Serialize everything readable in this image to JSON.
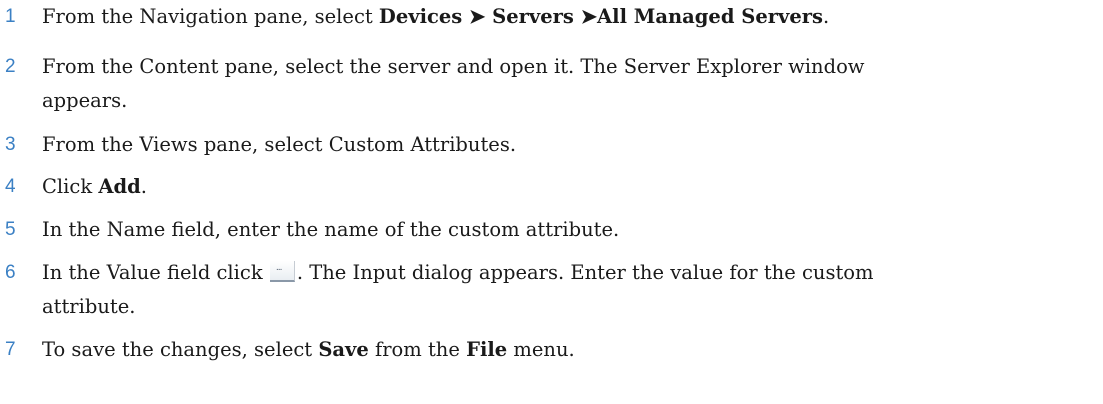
{
  "steps": [
    {
      "number": "1",
      "lines": [
        [
          {
            "text": "From the Navigation pane, select "
          },
          {
            "text": "Devices ➤ Servers ➤All Managed Servers",
            "bold": true
          },
          {
            "text": "."
          }
        ]
      ]
    },
    {
      "number": "2",
      "lines": [
        [
          {
            "text": "From the Content pane, select the server and open it. The Server Explorer window"
          }
        ],
        [
          {
            "text": "appears."
          }
        ]
      ]
    },
    {
      "number": "3",
      "lines": [
        [
          {
            "text": "From the Views pane, select Custom Attributes."
          }
        ]
      ]
    },
    {
      "number": "4",
      "lines": [
        [
          {
            "text": "Click "
          },
          {
            "text": "Add",
            "bold": true
          },
          {
            "text": "."
          }
        ]
      ]
    },
    {
      "number": "5",
      "lines": [
        [
          {
            "text": "In the Name field, enter the name of the custom attribute."
          }
        ]
      ]
    },
    {
      "number": "6",
      "lines": [
        [
          {
            "text": "In the Value field click "
          },
          {
            "icon": "ellipsis-button-icon",
            "text": "..."
          },
          {
            "text": ". The Input dialog appears. Enter the value for the custom"
          }
        ],
        [
          {
            "text": "attribute."
          }
        ]
      ]
    },
    {
      "number": "7",
      "lines": [
        [
          {
            "text": "To save the changes, select "
          },
          {
            "text": "Save",
            "bold": true
          },
          {
            "text": " from the "
          },
          {
            "text": "File",
            "bold": true
          },
          {
            "text": " menu."
          }
        ]
      ]
    }
  ],
  "colors": {
    "step_number": "#3b80c4",
    "body_text": "#1a1a1a",
    "background": "#ffffff"
  }
}
